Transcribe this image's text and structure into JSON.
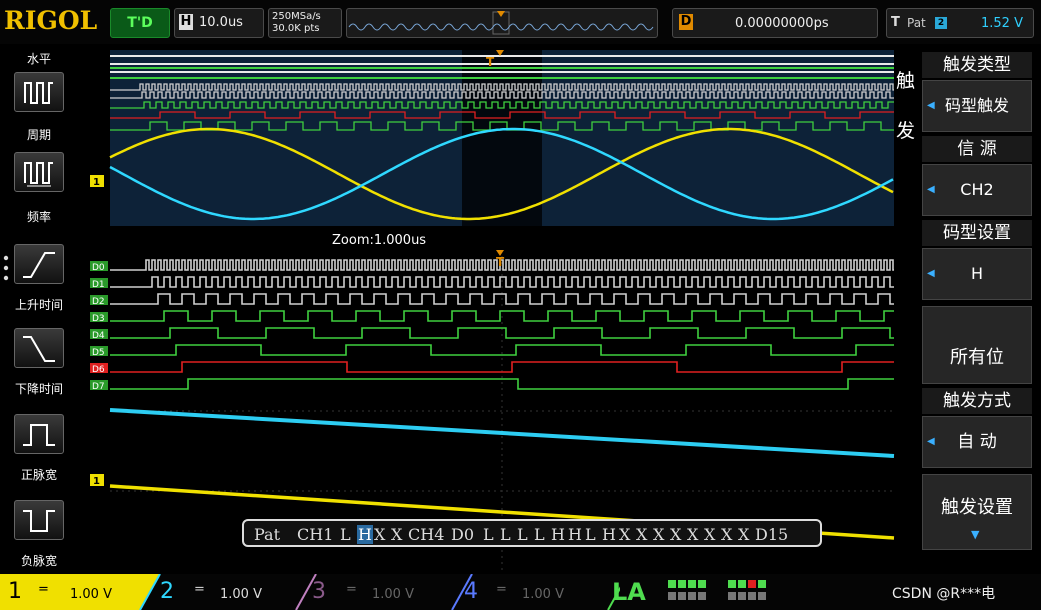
{
  "brand": "RIGOL",
  "top": {
    "trig_status": "T'D",
    "h_key": "H",
    "timebase": "10.0us",
    "sample_rate": "250MSa/s",
    "mem_depth": "30.0K pts",
    "d_key": "D",
    "delay": "0.00000000ps",
    "t_key": "T",
    "trig_src_short": "Pat",
    "trig_ch": "2",
    "trig_level": "1.52 V"
  },
  "left_menu": {
    "title": "水平",
    "items": [
      {
        "label": "周期",
        "icon": "period-icon"
      },
      {
        "label": "频率",
        "icon": "frequency-icon"
      },
      {
        "label": "上升时间",
        "icon": "rise-time-icon"
      },
      {
        "label": "下降时间",
        "icon": "fall-time-icon"
      },
      {
        "label": "正脉宽",
        "icon": "positive-width-icon"
      },
      {
        "label": "负脉宽",
        "icon": "negative-width-icon"
      }
    ]
  },
  "screen": {
    "zoom_label": "Zoom:1.000us",
    "digital_labels": [
      "D0",
      "D1",
      "D2",
      "D3",
      "D4",
      "D5",
      "D6",
      "D7"
    ],
    "channel_marker": "1",
    "trigger_marker": "T"
  },
  "pattern": {
    "items": [
      "Pat",
      "CH1",
      "L",
      "H",
      "X",
      "X",
      "CH4",
      "D0",
      "L",
      "L",
      "L",
      "L",
      "H",
      "H",
      "L",
      "H",
      "X",
      "X",
      "X",
      "X",
      "X",
      "X",
      "X",
      "X",
      "D15"
    ]
  },
  "right_menu": {
    "side_label_1": "触",
    "side_label_2": "发",
    "type_header": "触发类型",
    "type_value": "码型触发",
    "source_header": "信 源",
    "source_value": "CH2",
    "pattern_header": "码型设置",
    "pattern_value": "H",
    "all_bits": "所有位",
    "mode_header": "触发方式",
    "mode_value": "自 动",
    "setup": "触发设置"
  },
  "bottom": {
    "channels": [
      {
        "num": "1",
        "coupling": "=",
        "scale": "1.00 V",
        "color": "#f0e000",
        "active": true
      },
      {
        "num": "2",
        "coupling": "=",
        "scale": "1.00 V",
        "color": "#2fd8ff",
        "active": false
      },
      {
        "num": "3",
        "coupling": "=",
        "scale": "1.00 V",
        "color": "#c080c0",
        "active": false
      },
      {
        "num": "4",
        "coupling": "=",
        "scale": "1.00 V",
        "color": "#5a7aff",
        "active": false
      }
    ],
    "la_label": "LA",
    "watermark": "CSDN @R***电"
  },
  "colors": {
    "ch1": "#f0e000",
    "ch2": "#2fd8ff",
    "digital": "#4fdc4f",
    "digital_red": "#e02020",
    "brand": "#f0c000"
  }
}
